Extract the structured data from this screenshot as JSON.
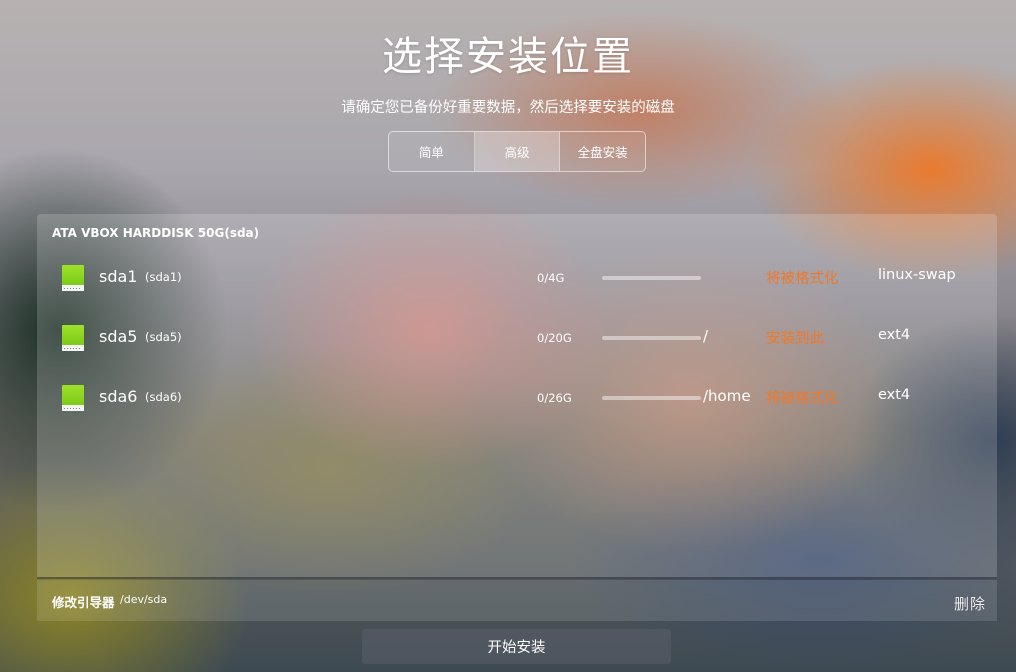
{
  "title": "选择安装位置",
  "subtitle": "请确定您已备份好重要数据，然后选择要安装的磁盘",
  "mode_tabs": [
    {
      "label": "简单",
      "active": false
    },
    {
      "label": "高级",
      "active": true
    },
    {
      "label": "全盘安装",
      "active": false
    }
  ],
  "disk": {
    "name": "ATA VBOX HARDDISK 50G(sda)",
    "partitions": [
      {
        "name": "sda1",
        "label": "(sda1)",
        "size": "0/4G",
        "used_fraction": 0,
        "mount": "",
        "status": "将被格式化",
        "fs": "linux-swap"
      },
      {
        "name": "sda5",
        "label": "(sda5)",
        "size": "0/20G",
        "used_fraction": 0,
        "mount": "/",
        "status": "安装到此",
        "fs": "ext4"
      },
      {
        "name": "sda6",
        "label": "(sda6)",
        "size": "0/26G",
        "used_fraction": 0,
        "mount": "/home",
        "status": "将被格式化",
        "fs": "ext4"
      }
    ]
  },
  "bootloader": {
    "label": "修改引导器",
    "path": "/dev/sda",
    "delete_label": "删除"
  },
  "install_button": "开始安装",
  "colors": {
    "status": "#f0782a",
    "partition_icon": "#8fd41f"
  },
  "icons": {
    "partition": "partition-icon"
  }
}
